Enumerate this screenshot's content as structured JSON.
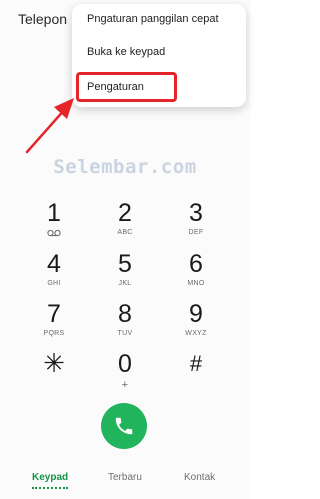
{
  "app": {
    "title": "Telepon"
  },
  "menu": {
    "items": [
      {
        "label": "Pngaturan panggilan cepat"
      },
      {
        "label": "Buka ke keypad"
      },
      {
        "label": "Pengaturan"
      }
    ],
    "highlighted_item": "Pengaturan",
    "highlight_color": "#e4262a"
  },
  "watermark": {
    "text": "Selembar.com"
  },
  "keypad": {
    "keys": [
      {
        "digit": "1",
        "letters": "",
        "icon": "voicemail-icon"
      },
      {
        "digit": "2",
        "letters": "ABC"
      },
      {
        "digit": "3",
        "letters": "DEF"
      },
      {
        "digit": "4",
        "letters": "GHI"
      },
      {
        "digit": "5",
        "letters": "JKL"
      },
      {
        "digit": "6",
        "letters": "MNO"
      },
      {
        "digit": "7",
        "letters": "PQRS"
      },
      {
        "digit": "8",
        "letters": "TUV"
      },
      {
        "digit": "9",
        "letters": "WXYZ"
      },
      {
        "digit": "✳",
        "letters": ""
      },
      {
        "digit": "0",
        "letters": "+"
      },
      {
        "digit": "#",
        "letters": ""
      }
    ]
  },
  "call_button": {
    "icon": "phone-icon",
    "color": "#22b35d"
  },
  "bottom_nav": {
    "tabs": [
      {
        "label": "Keypad",
        "active": true
      },
      {
        "label": "Terbaru",
        "active": false
      },
      {
        "label": "Kontak",
        "active": false
      }
    ],
    "active_color": "#13924a"
  }
}
